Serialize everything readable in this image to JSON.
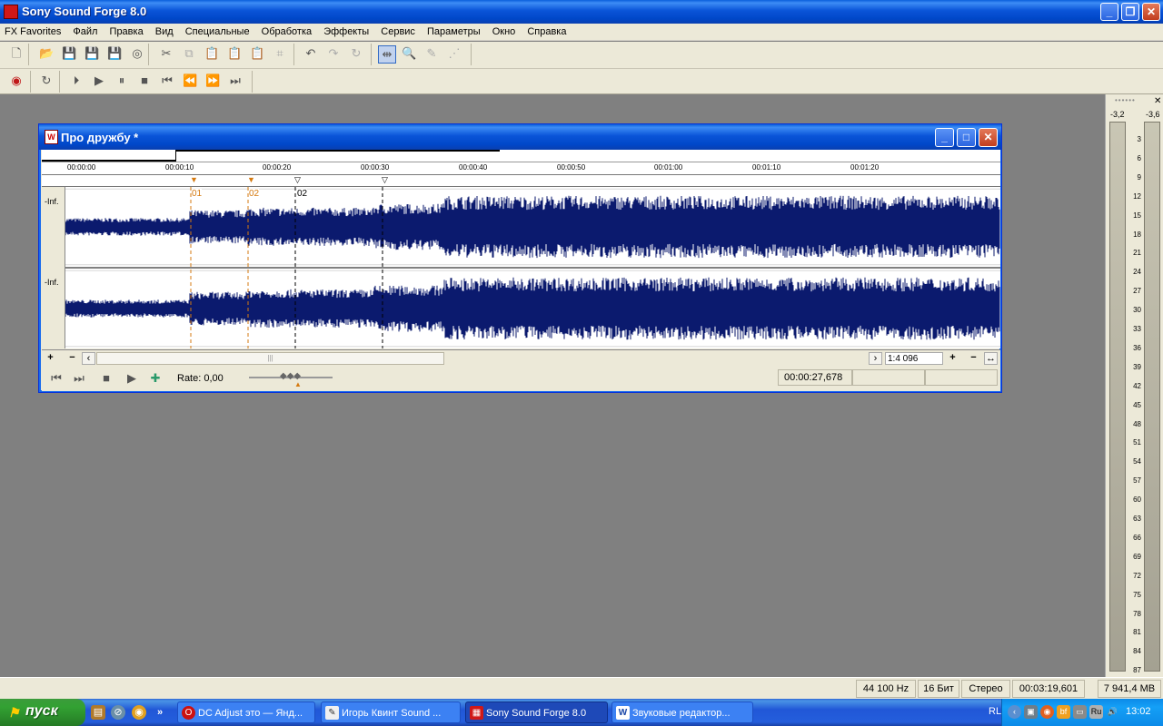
{
  "app": {
    "title": "Sony Sound Forge 8.0"
  },
  "menu": [
    "FX Favorites",
    "Файл",
    "Правка",
    "Вид",
    "Специальные",
    "Обработка",
    "Эффекты",
    "Сервис",
    "Параметры",
    "Окно",
    "Справка"
  ],
  "document": {
    "title": "Про дружбу *",
    "ruler_ticks": [
      "00:00:00",
      "00:00:10",
      "00:00:20",
      "00:00:30",
      "00:00:40",
      "00:00:50",
      "00:01:00",
      "00:01:10",
      "00:01:20"
    ],
    "markers": [
      "01",
      "02",
      "02"
    ],
    "channel_label": "-Inf.",
    "zoom": "1:4 096",
    "rate": "Rate: 0,00",
    "position": "00:00:27,678"
  },
  "meters": {
    "peak_left": "-3,2",
    "peak_right": "-3,6",
    "scale": [
      "3",
      "6",
      "9",
      "12",
      "15",
      "18",
      "21",
      "24",
      "27",
      "30",
      "33",
      "36",
      "39",
      "42",
      "45",
      "48",
      "51",
      "54",
      "57",
      "60",
      "63",
      "66",
      "69",
      "72",
      "75",
      "78",
      "81",
      "84",
      "87"
    ]
  },
  "status": {
    "sample_rate": "44 100 Hz",
    "bit_depth": "16 Бит",
    "channels": "Стерео",
    "length": "00:03:19,601",
    "free_space": "7 941,4 MB"
  },
  "taskbar": {
    "start": "пуск",
    "tasks": [
      "DC Adjust это — Янд...",
      "Игорь Квинт Sound ...",
      "Sony Sound Forge 8.0",
      "Звуковые редактор..."
    ],
    "lang": "RL",
    "clock": "13:02"
  },
  "colors": {
    "waveform": "#0b1a6e",
    "titlebar": "#0a54d8",
    "marker": "#d57a10"
  }
}
